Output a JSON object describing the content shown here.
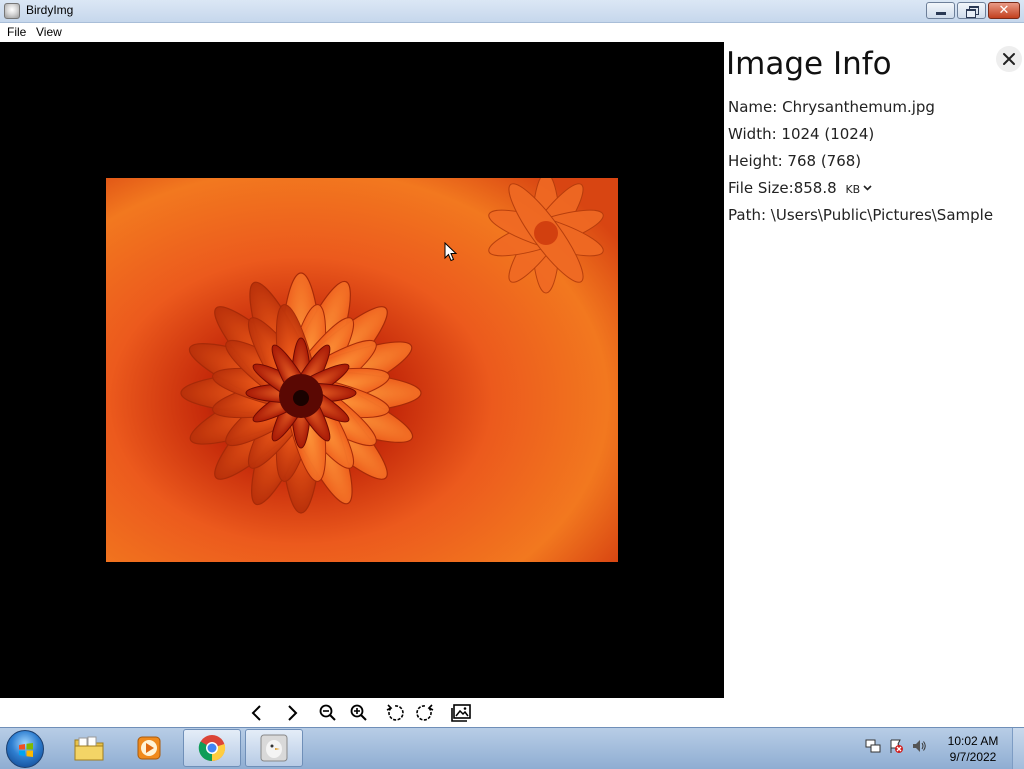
{
  "window": {
    "title": "BirdyImg",
    "icon": "birdyimg-app-icon",
    "controls": [
      "minimize",
      "maximize",
      "close"
    ]
  },
  "menu": {
    "file": "File",
    "view": "View"
  },
  "image_info": {
    "title": "Image Info",
    "name_label": "Name:",
    "name_value": "Chrysanthemum.jpg",
    "width_label": "Width:",
    "width_value": "1024 (1024)",
    "height_label": "Height:",
    "height_value": "768 (768)",
    "filesize_label": "File Size:",
    "filesize_value": "858.8",
    "filesize_unit": "KB",
    "path_label": "Path:",
    "path_value": "\\Users\\Public\\Pictures\\Sample"
  },
  "toolbar": {
    "icons": [
      "previous-icon",
      "next-icon",
      "zoom-out-icon",
      "zoom-in-icon",
      "rotate-left-icon",
      "rotate-right-icon",
      "gallery-icon"
    ]
  },
  "taskbar": {
    "pinned": [
      "windows-explorer",
      "windows-media-player",
      "google-chrome",
      "birdyimg"
    ],
    "active": "birdyimg",
    "clock_time": "10:02 AM",
    "clock_date": "9/7/2022"
  },
  "colors": {
    "viewer_background": "#000000",
    "panel_background": "#ffffff",
    "photo_primary": "#e8501a",
    "taskbar": "#a9c2e1"
  }
}
